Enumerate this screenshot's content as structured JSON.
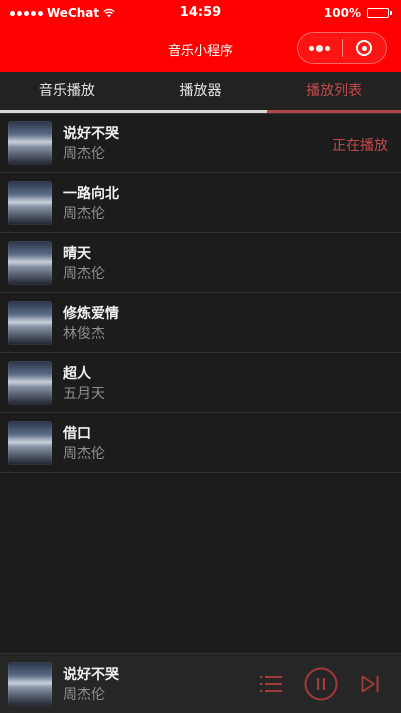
{
  "status_bar": {
    "carrier": "WeChat",
    "time": "14:59",
    "battery": "100%"
  },
  "nav": {
    "title": "音乐小程序"
  },
  "tabs": [
    {
      "label": "音乐播放",
      "active": false
    },
    {
      "label": "播放器",
      "active": false
    },
    {
      "label": "播放列表",
      "active": true
    }
  ],
  "playlist": {
    "now_playing_label": "正在播放",
    "songs": [
      {
        "title": "说好不哭",
        "artist": "周杰伦"
      },
      {
        "title": "一路向北",
        "artist": "周杰伦"
      },
      {
        "title": "晴天",
        "artist": "周杰伦"
      },
      {
        "title": "修炼爱情",
        "artist": "林俊杰"
      },
      {
        "title": "超人",
        "artist": "五月天"
      },
      {
        "title": "借口",
        "artist": "周杰伦"
      }
    ]
  },
  "player": {
    "title": "说好不哭",
    "artist": "周杰伦",
    "icons": [
      "playlist-icon",
      "pause-icon",
      "next-icon"
    ]
  },
  "colors": {
    "brand": "#ff0000",
    "accent": "#c04a4a",
    "background": "#1c1c1c"
  }
}
